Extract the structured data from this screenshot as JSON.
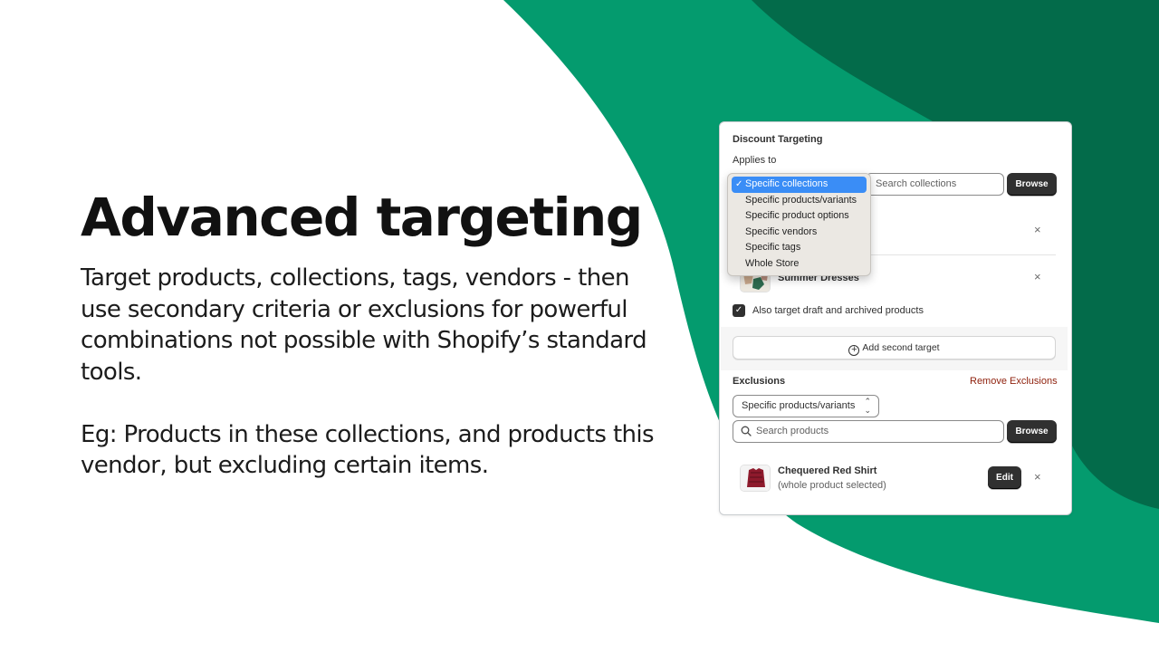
{
  "colors": {
    "green_light": "#049b6e",
    "green_dark": "#036b4a",
    "accent_blue": "#3a8df6",
    "danger_text": "#8e1f0b"
  },
  "hero": {
    "title": "Advanced targeting",
    "paragraph_1": "Target products, collections, tags, vendors - then use secondary criteria or exclusions for powerful combinations not possible with Shopify’s standard tools.",
    "paragraph_2": "Eg: Products in these collections, and products this vendor, but excluding certain items."
  },
  "card": {
    "title": "Discount Targeting",
    "applies_to_label": "Applies to",
    "dropdown": {
      "options": [
        "Specific collections",
        "Specific products/variants",
        "Specific product options",
        "Specific vendors",
        "Specific tags",
        "Whole Store"
      ],
      "selected": "Specific collections",
      "selected_mark": "✓"
    },
    "search_collections_placeholder": "Search collections",
    "browse_label": "Browse",
    "remove_glyph": "×",
    "collection_item": {
      "name": "Summer Dresses",
      "thumb_icon": "dress-photo-icon"
    },
    "checkbox": {
      "checked": true,
      "label": "Also target draft and archived products"
    },
    "add_second_target_label": "Add second target",
    "exclusions": {
      "label": "Exclusions",
      "remove_label": "Remove Exclusions",
      "select_value": "Specific products/variants",
      "search_placeholder": "Search products",
      "browse_label": "Browse",
      "product": {
        "name": "Chequered Red Shirt",
        "subtitle": "(whole product selected)",
        "edit_label": "Edit",
        "thumb_icon": "shirt-photo-icon"
      }
    }
  }
}
